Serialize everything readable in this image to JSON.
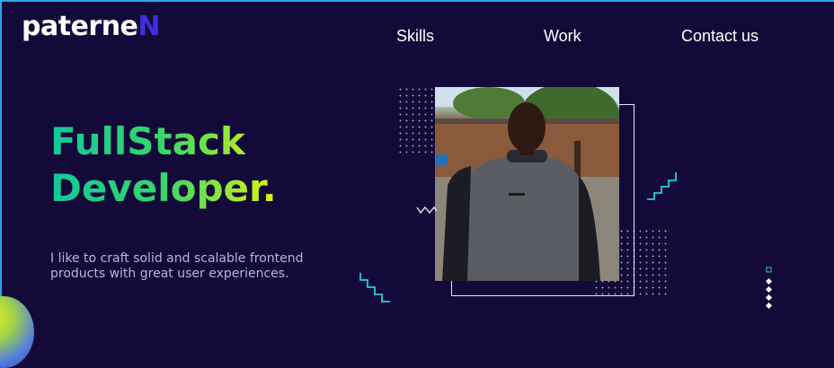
{
  "brand": {
    "logo_main": "paterne",
    "logo_accent": "N"
  },
  "nav": {
    "items": [
      {
        "label": "Skills"
      },
      {
        "label": "Work"
      },
      {
        "label": "Contact us"
      }
    ]
  },
  "hero": {
    "title_line1": "FullStack",
    "title_line2": "Developer.",
    "subtitle": "I like to craft solid and scalable frontend products with great user experiences."
  },
  "colors": {
    "background": "#140a3a",
    "logo_accent": "#3d2ee0",
    "title_gradient_start": "#12c89a",
    "title_gradient_end": "#e0f50e",
    "deco_cyan": "#1fd0d8"
  }
}
